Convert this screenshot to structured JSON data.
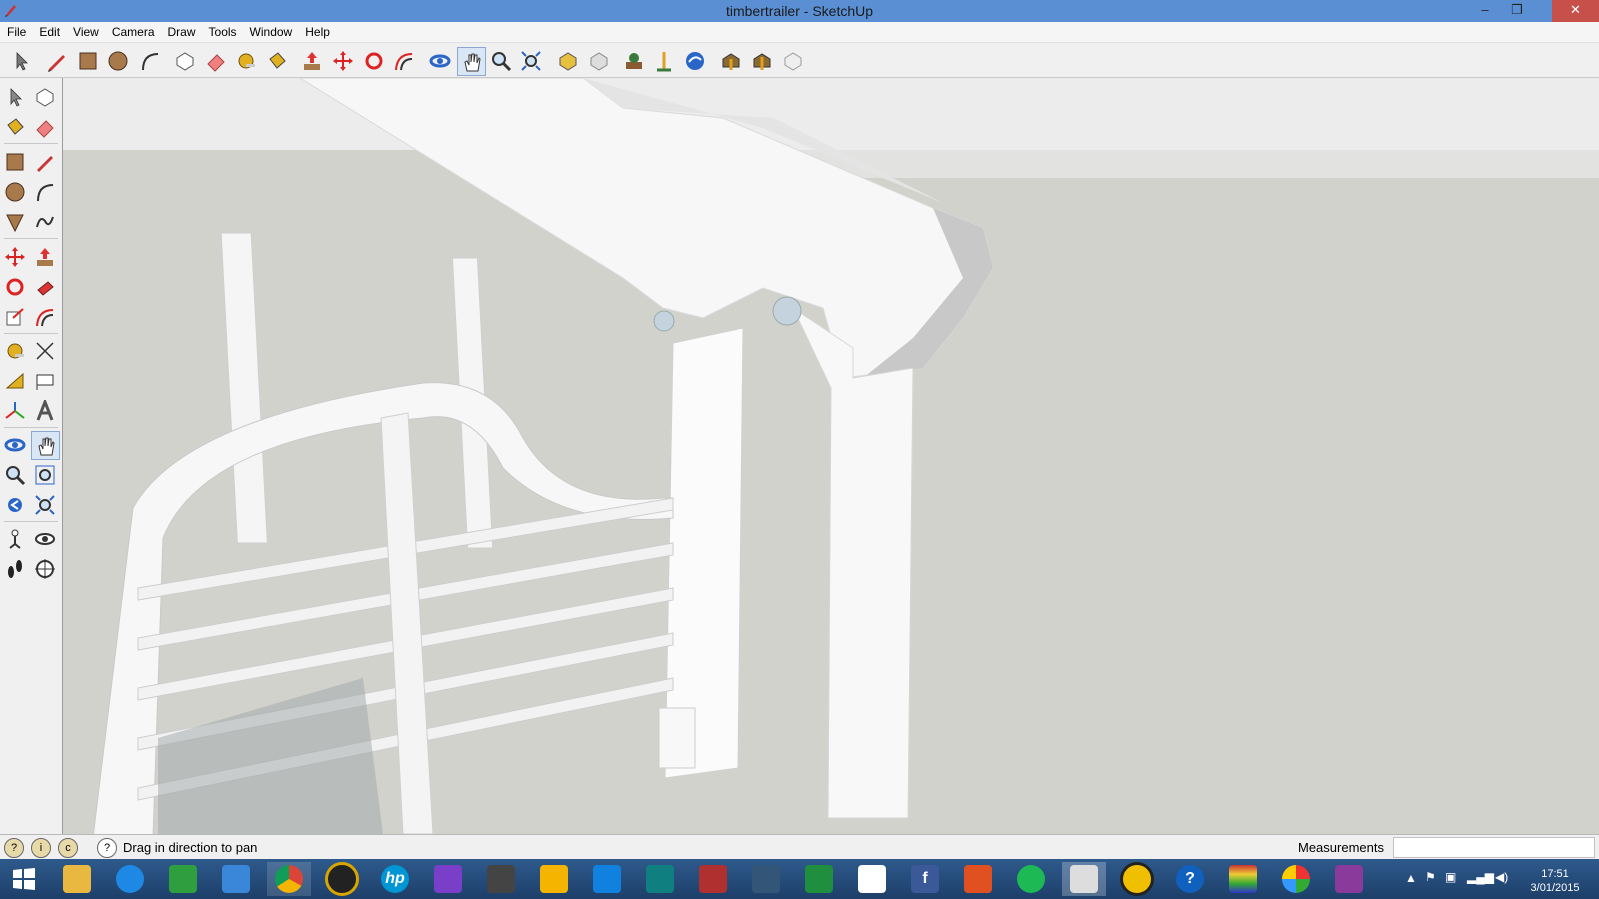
{
  "window": {
    "title": "timbertrailer - SketchUp",
    "minimize": "–",
    "restore": "❐",
    "close": "✕"
  },
  "menu": [
    "File",
    "Edit",
    "View",
    "Camera",
    "Draw",
    "Tools",
    "Window",
    "Help"
  ],
  "status": {
    "hint": "Drag in direction to pan",
    "measurements_label": "Measurements",
    "measurements_value": ""
  },
  "clock": {
    "time": "17:51",
    "date": "3/01/2015"
  },
  "taskbar": {
    "hp_label": "hp",
    "facebook_label": "f",
    "help_label": "?"
  },
  "colors": {
    "titlebar": "#5b8fd4",
    "close": "#c7504a",
    "viewport_bg": "#d2d2cd",
    "sky": "#ececec"
  }
}
